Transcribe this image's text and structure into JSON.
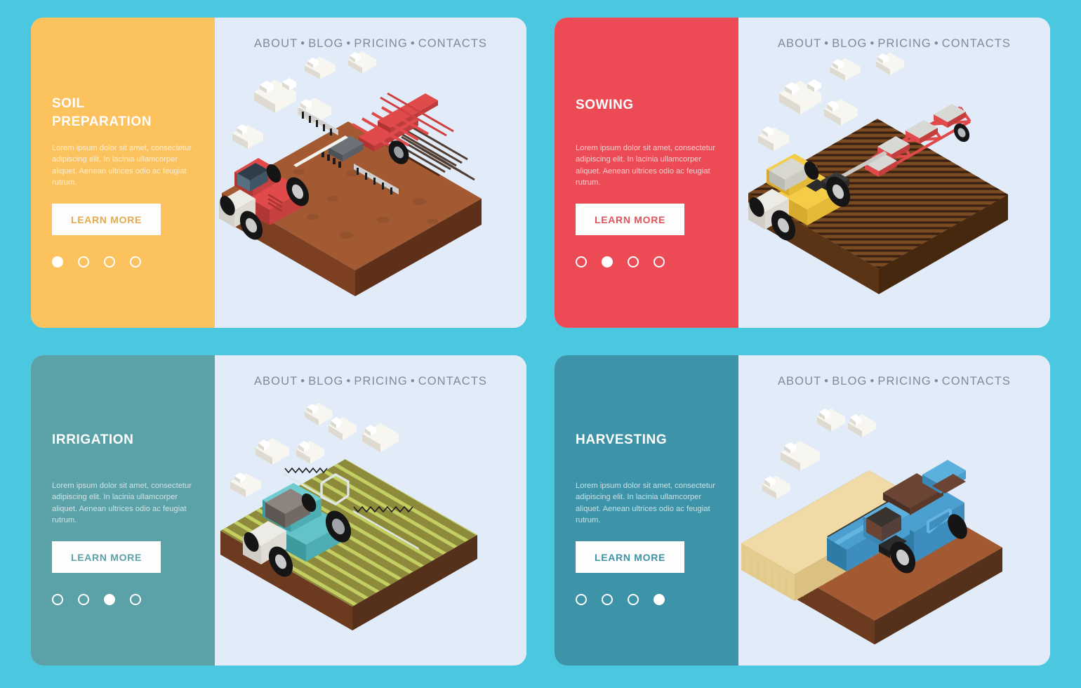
{
  "background_color": "#4bc8e0",
  "card_bg_color": "#e1ecf8",
  "nav": {
    "items": [
      "ABOUT",
      "BLOG",
      "PRICING",
      "CONTACTS"
    ],
    "separator": "•",
    "color": "#7d8b99"
  },
  "common": {
    "button_label": "LEARN MORE",
    "description": "Lorem ipsum dolor sit amet, consectetur adipiscing elit. In lacinia ullamcorper aliquet. Aenean ultrices odio ac feugiat rutrum.",
    "dot_count": 4
  },
  "cards": [
    {
      "id": "soil-preparation",
      "title": "SOIL\nPREPARATION",
      "title_line1": "SOIL",
      "title_line2": "PREPARATION",
      "accent_color": "#fbc25e",
      "button_label": "LEARN MORE",
      "description": "Lorem ipsum dolor sit amet, consectetur adipiscing elit. In lacinia ullamcorper aliquet. Aenean ultrices odio ac feugiat rutrum.",
      "active_dot": 0,
      "scene": {
        "field_color_top": "#a35a33",
        "field_color_side": "#6b3a1f",
        "vehicle": "red-tractor-with-harrow",
        "vehicle_color": "#e04a4a",
        "cloud_count": 6
      }
    },
    {
      "id": "sowing",
      "title": "SOWING",
      "title_line1": "SOWING",
      "title_line2": "",
      "accent_color": "#ec4b55",
      "button_label": "LEARN MORE",
      "description": "Lorem ipsum dolor sit amet, consectetur adipiscing elit. In lacinia ullamcorper aliquet. Aenean ultrices odio ac feugiat rutrum.",
      "active_dot": 1,
      "scene": {
        "field_color_top": "#7a4a22",
        "field_color_side": "#5a3415",
        "vehicle": "yellow-tractor-with-seeder",
        "vehicle_color": "#f5cc46",
        "cloud_count": 6
      }
    },
    {
      "id": "irrigation",
      "title": "IRRIGATION",
      "title_line1": "IRRIGATION",
      "title_line2": "",
      "accent_color": "#5ba1a8",
      "button_label": "LEARN MORE",
      "description": "Lorem ipsum dolor sit amet, consectetur adipiscing elit. In lacinia ullamcorper aliquet. Aenean ultrices odio ac feugiat rutrum.",
      "active_dot": 2,
      "scene": {
        "field_color_top": "#a4b04e",
        "field_color_side": "#6b3a1f",
        "vehicle": "teal-tractor-with-sprayer",
        "vehicle_color": "#63c3c8",
        "cloud_count": 6
      }
    },
    {
      "id": "harvesting",
      "title": "HARVESTING",
      "title_line1": "HARVESTING",
      "title_line2": "",
      "accent_color": "#3d93a8",
      "button_label": "LEARN MORE",
      "description": "Lorem ipsum dolor sit amet, consectetur adipiscing elit. In lacinia ullamcorper aliquet. Aenean ultrices odio ac feugiat rutrum.",
      "active_dot": 3,
      "scene": {
        "field_color_top": "#f0dba6",
        "field_color_side": "#6b3a1f",
        "vehicle": "blue-combine-harvester",
        "vehicle_color": "#4a9fd0",
        "cloud_count": 5
      }
    }
  ]
}
